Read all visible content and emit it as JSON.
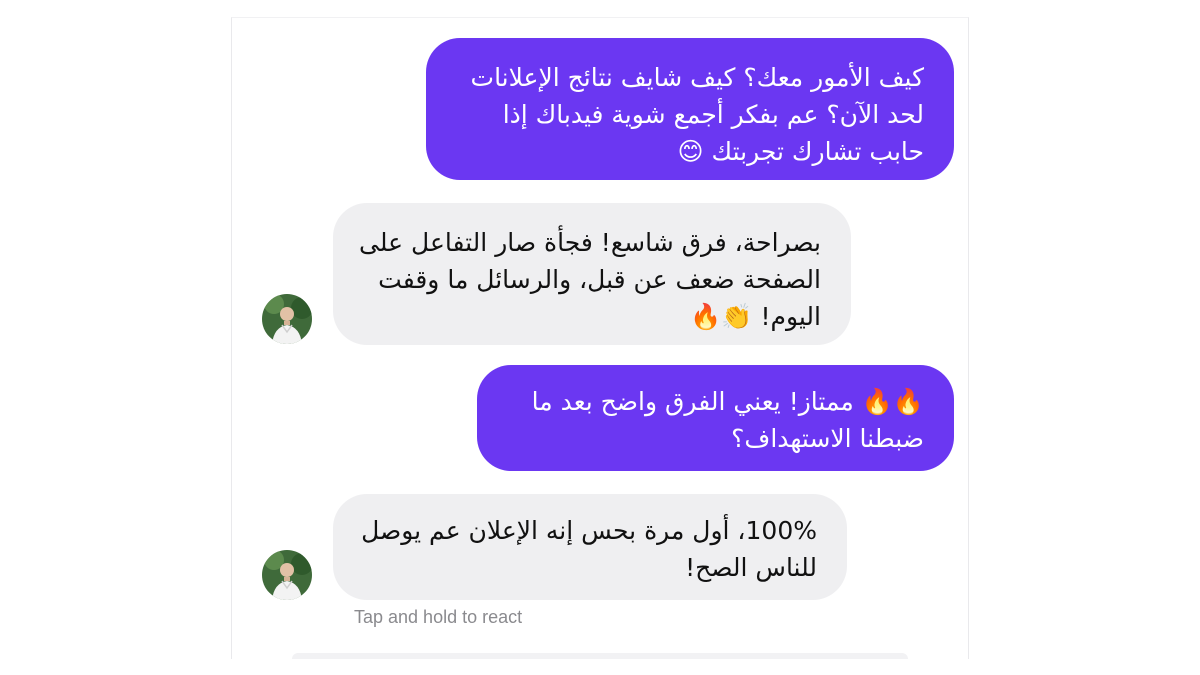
{
  "messages": [
    {
      "direction": "outgoing",
      "text": "كيف الأمور معك؟ كيف شايف نتائج الإعلانات\nلحد الآن؟ عم بفكر أجمع شوية فيدباك إذا\nحابب تشارك تجربتك 😊"
    },
    {
      "direction": "incoming",
      "text": "بصراحة، فرق شاسع! فجأة صار التفاعل على\nالصفحة ضعف عن قبل، والرسائل ما وقفت\nاليوم! 👏🔥"
    },
    {
      "direction": "outgoing",
      "text": "🔥🔥 ممتاز! يعني الفرق واضح بعد ما\nضبطنا الاستهداف؟"
    },
    {
      "direction": "incoming",
      "text": "100%، أول مرة بحس إنه الإعلان عم يوصل\nللناس الصح!"
    }
  ],
  "hint": "Tap and hold to react",
  "colors": {
    "outgoing_bubble": "#6b37f2",
    "incoming_bubble": "#efeff1",
    "hint_text": "#8a8a8e"
  }
}
